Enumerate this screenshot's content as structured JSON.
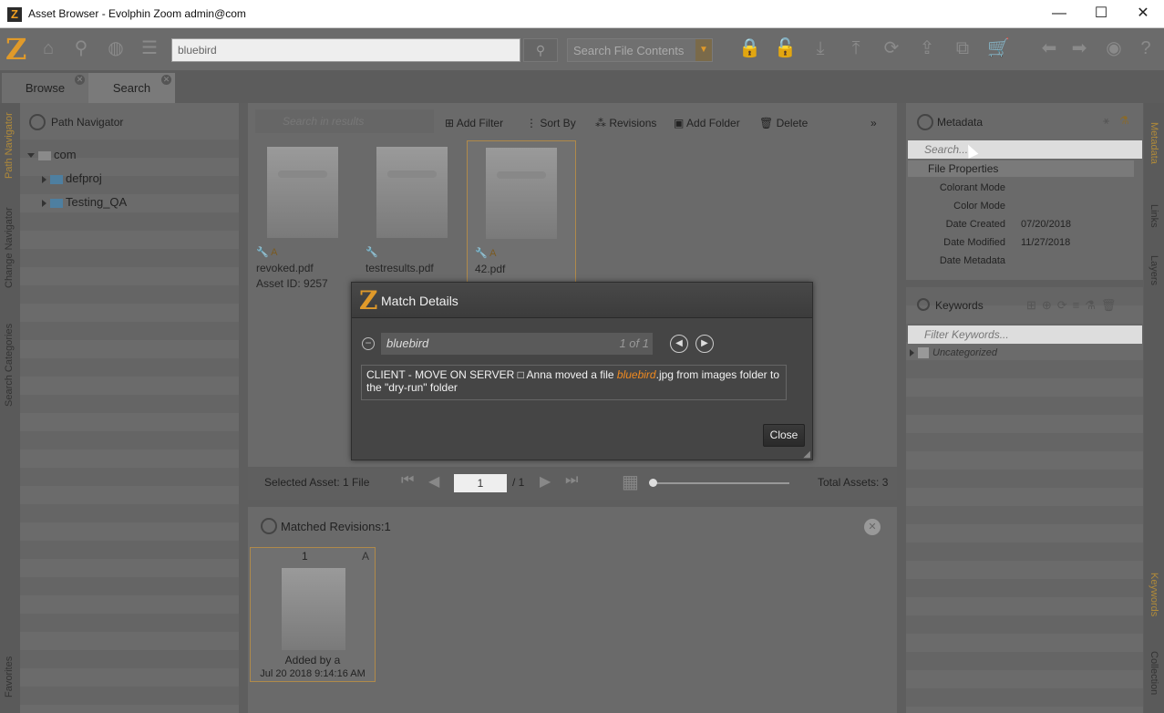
{
  "window": {
    "title": "Asset Browser - Evolphin Zoom admin@com",
    "app_icon": "Z",
    "minimize": "—",
    "maximize": "☐",
    "close": "✕"
  },
  "toolbar": {
    "logo": "Z",
    "search_value": "bluebird",
    "search_scope": "Search File Contents"
  },
  "tabs": [
    {
      "label": "Browse"
    },
    {
      "label": "Search"
    }
  ],
  "left_rail": {
    "path_navigator": "Path Navigator",
    "change_navigator": "Change Navigator",
    "search_categories": "Search Categories",
    "favorites": "Favorites"
  },
  "right_rail": {
    "metadata": "Metadata",
    "links": "Links",
    "layers": "Layers",
    "keywords": "Keywords",
    "collection": "Collection"
  },
  "path_navigator": {
    "title": "Path Navigator",
    "root": "com",
    "children": [
      "defproj",
      "Testing_QA"
    ]
  },
  "results_toolbar": {
    "search_placeholder": "Search in results",
    "add_filter": "Add Filter",
    "sort_by": "Sort By",
    "revisions": "Revisions",
    "add_folder": "Add Folder",
    "delete": "Delete"
  },
  "assets": [
    {
      "name": "revoked.pdf",
      "asset_id": "Asset ID: 9257",
      "badge": "🔧 A"
    },
    {
      "name": "testresults.pdf",
      "asset_id": "",
      "badge": "🔧"
    },
    {
      "name": "42.pdf",
      "asset_id": "",
      "badge": "🔧 A"
    }
  ],
  "pager": {
    "selected": "Selected Asset: 1 File",
    "page": "1",
    "total_pages": "/ 1",
    "total_assets": "Total Assets: 3"
  },
  "matched_revisions": {
    "title": "Matched Revisions:1",
    "revision_number": "1",
    "added_by": "Added by a",
    "date": "Jul 20 2018 9:14:16 AM"
  },
  "modal": {
    "logo": "Z",
    "title": "Match Details",
    "term": "bluebird",
    "count": "1 of 1",
    "text_before": "CLIENT - MOVE ON SERVER □ Anna moved a file ",
    "text_highlight": "bluebird",
    "text_after": ".jpg from images folder to the \"dry-run\" folder",
    "close_label": "Close"
  },
  "metadata": {
    "title": "Metadata",
    "search_placeholder": "Search...",
    "group": "File Properties",
    "rows": [
      {
        "key": "Colorant Mode",
        "value": ""
      },
      {
        "key": "Color Mode",
        "value": ""
      },
      {
        "key": "Date Created",
        "value": "07/20/2018"
      },
      {
        "key": "Date Modified",
        "value": "11/27/2018"
      },
      {
        "key": "Date Metadata",
        "value": ""
      }
    ]
  },
  "keywords": {
    "title": "Keywords",
    "filter_placeholder": "Filter Keywords...",
    "items": [
      "Uncategorized"
    ]
  },
  "colors": {
    "accent": "#e09a2a",
    "highlight": "#f08a20",
    "panel": "#676767",
    "modal": "#454545"
  }
}
